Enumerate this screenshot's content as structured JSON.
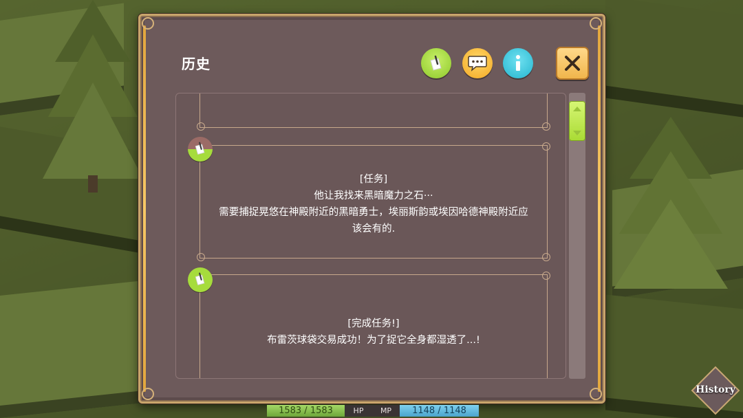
{
  "dialog": {
    "title": "历史",
    "buttons": {
      "notes_icon": "quill-note-icon",
      "chat_icon": "speech-bubble-icon",
      "info_icon": "info-icon",
      "close_icon": "close-icon"
    }
  },
  "entries": [
    {
      "badge_icon": "quill-note-icon",
      "badge_colors": {
        "top": "#9b6b66",
        "bottom": "#a6dc3c"
      },
      "tag": "[任务]",
      "lines": [
        "他让我找来黑暗魔力之石···",
        "需要捕捉晃悠在神殿附近的黑暗勇士，埃丽斯韵或埃因哈德神殿附近应",
        "该会有的."
      ]
    },
    {
      "badge_icon": "quill-note-icon",
      "badge_colors": {
        "top": "#a6dc3c",
        "bottom": "#a6dc3c"
      },
      "tag": "[完成任务!]",
      "lines": [
        "布雷茨球袋交易成功！为了捉它全身都湿透了...!"
      ]
    }
  ],
  "hud": {
    "hp_value": "1583 / 1583",
    "hp_label": "HP",
    "mp_label": "MP",
    "mp_value": "1148 / 1148"
  },
  "history_button": {
    "label": "History"
  },
  "colors": {
    "accent_green": "#a6dc3c",
    "accent_orange": "#f3a923",
    "accent_cyan": "#25b6cf",
    "panel_bg": "#6d5a5b",
    "frame_gold": "#c9a56b"
  }
}
